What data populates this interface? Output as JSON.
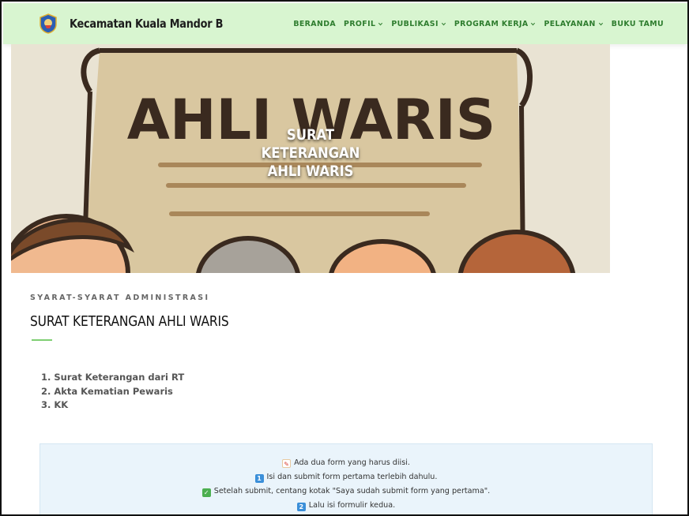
{
  "header": {
    "site_title": "Kecamatan Kuala Mandor B",
    "nav": [
      {
        "label": "BERANDA",
        "dropdown": false
      },
      {
        "label": "PROFIL",
        "dropdown": true
      },
      {
        "label": "PUBLIKASI",
        "dropdown": true
      },
      {
        "label": "PROGRAM KERJA",
        "dropdown": true
      },
      {
        "label": "PELAYANAN",
        "dropdown": true
      },
      {
        "label": "BUKU TAMU",
        "dropdown": false
      }
    ]
  },
  "hero": {
    "image_text": "AHLI WARIS",
    "overlay_lines": [
      "SURAT",
      "KETERANGAN",
      "AHLI WARIS"
    ]
  },
  "content": {
    "kicker": "SYARAT-SYARAT ADMINISTRASI",
    "title": "SURAT KETERANGAN AHLI WARIS",
    "requirements": [
      "1. Surat Keterangan dari RT",
      "2. Akta Kematian Pewaris",
      "3. KK"
    ]
  },
  "notice": {
    "lines": [
      {
        "icon": "memo-icon",
        "text": "Ada dua form yang harus diisi."
      },
      {
        "icon": "keycap-1-icon",
        "text": "Isi dan submit form pertama terlebih dahulu."
      },
      {
        "icon": "check-box-icon",
        "text": "Setelah submit, centang kotak \"Saya sudah submit form yang pertama\"."
      },
      {
        "icon": "keycap-2-icon",
        "text": "Lalu isi formulir kedua."
      }
    ]
  },
  "colors": {
    "header_bg": "#d8f5d0",
    "nav_text": "#2f7d2f",
    "accent_green": "#7fcf73",
    "notice_bg": "#eaf4fb",
    "keycap_blue": "#3b8fd9",
    "check_green": "#4caf50"
  }
}
